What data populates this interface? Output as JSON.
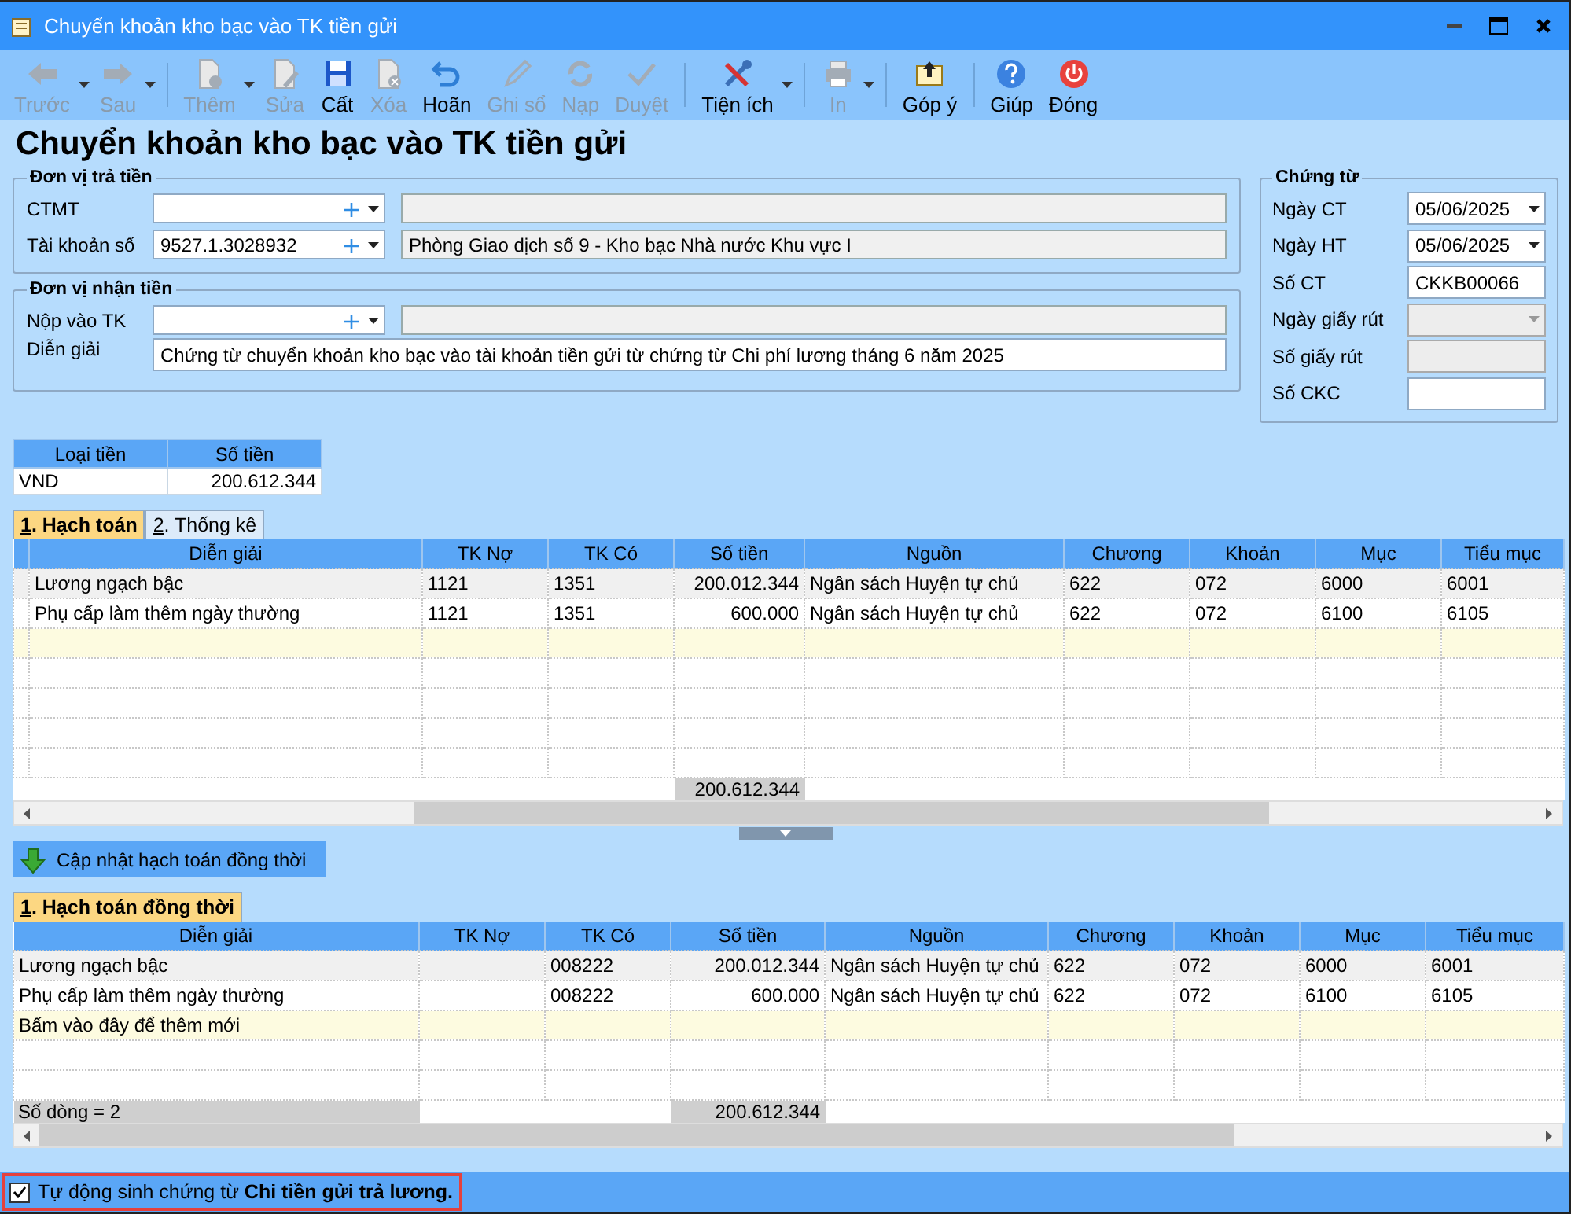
{
  "window": {
    "title": "Chuyển khoản kho bạc vào TK tiền gửi"
  },
  "toolbar": [
    {
      "label": "Trước",
      "kind": "arrow-left",
      "disabled": true,
      "dropdown": true,
      "separator_before": false
    },
    {
      "label": "Sau",
      "kind": "arrow-right",
      "disabled": true,
      "dropdown": true,
      "separator_before": false
    },
    {
      "label": "Thêm",
      "kind": "page-add",
      "disabled": true,
      "dropdown": true,
      "separator_before": true
    },
    {
      "label": "Sửa",
      "kind": "page-edit",
      "disabled": true,
      "dropdown": false,
      "separator_before": false
    },
    {
      "label": "Cất",
      "kind": "save",
      "disabled": false,
      "dropdown": false,
      "separator_before": false
    },
    {
      "label": "Xóa",
      "kind": "page-delete",
      "disabled": true,
      "dropdown": false,
      "separator_before": false
    },
    {
      "label": "Hoãn",
      "kind": "undo",
      "disabled": false,
      "dropdown": false,
      "separator_before": false
    },
    {
      "label": "Ghi sổ",
      "kind": "pencil",
      "disabled": true,
      "dropdown": false,
      "separator_before": false
    },
    {
      "label": "Nạp",
      "kind": "refresh",
      "disabled": true,
      "dropdown": false,
      "separator_before": false
    },
    {
      "label": "Duyệt",
      "kind": "check",
      "disabled": true,
      "dropdown": false,
      "separator_before": false
    },
    {
      "label": "Tiện ích",
      "kind": "tools",
      "disabled": false,
      "dropdown": true,
      "separator_before": true
    },
    {
      "label": "In",
      "kind": "printer",
      "disabled": true,
      "dropdown": true,
      "separator_before": true
    },
    {
      "label": "Góp ý",
      "kind": "envelope",
      "disabled": false,
      "dropdown": false,
      "separator_before": true
    },
    {
      "label": "Giúp",
      "kind": "help",
      "disabled": false,
      "dropdown": false,
      "separator_before": true
    },
    {
      "label": "Đóng",
      "kind": "power",
      "disabled": false,
      "dropdown": false,
      "separator_before": false
    }
  ],
  "heading": "Chuyển khoản kho bạc vào TK tiền gửi",
  "payer": {
    "title": "Đơn vị trả tiền",
    "rows": [
      {
        "label": "CTMT"
      },
      {
        "label": "Tài khoản số",
        "combo": "9527.1.3028932",
        "detail": "Phòng Giao dịch số 9 - Kho bạc Nhà nước Khu vực I"
      }
    ]
  },
  "payee": {
    "title": "Đơn vị nhận tiền",
    "rows": [
      {
        "kind": "combo",
        "label": "Nộp vào TK"
      },
      {
        "kind": "text",
        "label": "Diễn giải",
        "value": "Chứng từ chuyển khoản kho bạc vào tài khoản tiền gửi từ chứng từ Chi phí lương tháng 6 năm 2025"
      }
    ]
  },
  "voucher": {
    "title": "Chứng từ",
    "fields": [
      {
        "label": "Ngày CT",
        "kind": "date",
        "value": "05/06/2025",
        "disabled": false
      },
      {
        "label": "Ngày HT",
        "kind": "date",
        "value": "05/06/2025",
        "disabled": false
      },
      {
        "label": "Số CT",
        "kind": "text",
        "value": "CKKB00066",
        "disabled": false
      },
      {
        "label": "Ngày giấy rút",
        "kind": "date",
        "disabled": true
      },
      {
        "label": "Số giấy rút",
        "kind": "text",
        "disabled": true
      },
      {
        "label": "Số CKC",
        "kind": "text",
        "disabled": false
      }
    ]
  },
  "currency": {
    "columns": [
      "Loại tiền",
      "Số tiền"
    ],
    "rows": [
      [
        "VND",
        "200.612.344"
      ]
    ]
  },
  "tabs": [
    {
      "label": "1. Hạch toán",
      "selected": true
    },
    {
      "label": "2. Thống kê",
      "selected": false
    }
  ],
  "entries": {
    "columns": [
      {
        "label": "Diễn giải",
        "kind": "text"
      },
      {
        "label": "TK Nợ",
        "kind": "text"
      },
      {
        "label": "TK Có",
        "kind": "text"
      },
      {
        "label": "Số tiền",
        "kind": "amount"
      },
      {
        "label": "Nguồn",
        "kind": "text"
      },
      {
        "label": "Chương",
        "kind": "text"
      },
      {
        "label": "Khoản",
        "kind": "text"
      },
      {
        "label": "Mục",
        "kind": "text"
      },
      {
        "label": "Tiểu mục",
        "kind": "text"
      }
    ],
    "rows": [
      {
        "selected": true,
        "cells": [
          "Lương ngạch bậc",
          "1121",
          "1351",
          "200.012.344",
          "Ngân sách Huyện tự chủ",
          "622",
          "072",
          "6000",
          "6001"
        ]
      },
      {
        "selected": false,
        "cells": [
          "Phụ cấp làm thêm ngày thường",
          "1121",
          "1351",
          "600.000",
          "Ngân sách Huyện tự chủ",
          "622",
          "072",
          "6100",
          "6105"
        ]
      }
    ],
    "footer": {
      "total": "200.612.344"
    }
  },
  "update_button": "Cập nhật hạch toán đồng thời",
  "tabs2": [
    {
      "label": "1. Hạch toán đồng thời",
      "selected": true
    }
  ],
  "concurrent": {
    "columns": [
      {
        "label": "Diễn giải",
        "kind": "text"
      },
      {
        "label": "TK Nợ",
        "kind": "text"
      },
      {
        "label": "TK Có",
        "kind": "text"
      },
      {
        "label": "Số tiền",
        "kind": "amount"
      },
      {
        "label": "Nguồn",
        "kind": "text"
      },
      {
        "label": "Chương",
        "kind": "text"
      },
      {
        "label": "Khoản",
        "kind": "text"
      },
      {
        "label": "Mục",
        "kind": "text"
      },
      {
        "label": "Tiểu mục",
        "kind": "text"
      }
    ],
    "rows": [
      {
        "selected": true,
        "cells": [
          "Lương ngạch bậc",
          null,
          "008222",
          "200.012.344",
          "Ngân sách Huyện tự chủ",
          "622",
          "072",
          "6000",
          "6001"
        ]
      },
      {
        "selected": false,
        "cells": [
          "Phụ cấp làm thêm ngày thường",
          null,
          "008222",
          "600.000",
          "Ngân sách Huyện tự chủ",
          "622",
          "072",
          "6100",
          "6105"
        ]
      }
    ],
    "new_row": "Bấm vào đây để thêm mới",
    "footer": {
      "label": "Số dòng = 2",
      "total": "200.612.344"
    }
  },
  "auto_generate": {
    "checked": true,
    "label": "Tự động sinh chứng từ **Chi tiền gửi trả lương.**"
  }
}
